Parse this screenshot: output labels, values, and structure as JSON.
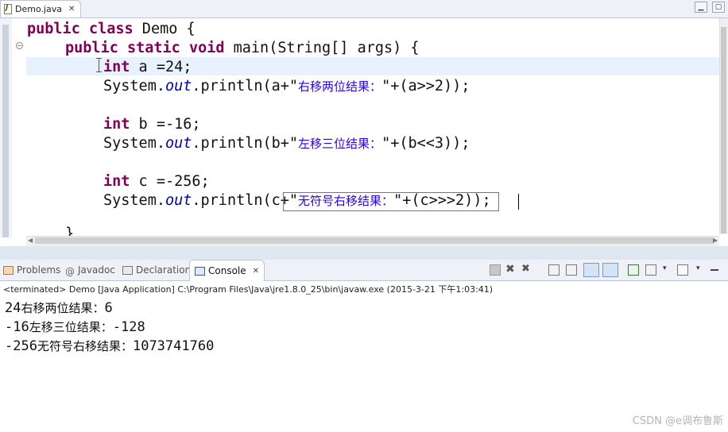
{
  "editor": {
    "tab_name": "Demo.java",
    "tab_close": "✕",
    "code": {
      "l1_kw1": "public",
      "l1_kw2": "class",
      "l1_rest": " Demo {",
      "l2_kw1": "public",
      "l2_kw2": "static",
      "l2_kw3": "void",
      "l2_rest": " main(String[] args) {",
      "l3_kw": "int",
      "l3_rest": " a =24;",
      "l4_a": "System.",
      "l4_out": "out",
      "l4_b": ".println(a+\"",
      "l4_str": "右移两位结果：",
      "l4_c": "\"+(a>>2));",
      "l6_kw": "int",
      "l6_rest": " b =-16;",
      "l7_a": "System.",
      "l7_out": "out",
      "l7_b": ".println(b+\"",
      "l7_str": "左移三位结果：",
      "l7_c": "\"+(b<<3));",
      "l9_kw": "int",
      "l9_rest": " c =-256;",
      "l10_a": "System.",
      "l10_out": "out",
      "l10_b": ".println(c+\"",
      "l10_str": "无符号右移结果：",
      "l10_c": "\"+(c>>>2));",
      "l11": "}"
    }
  },
  "views": {
    "tabs": [
      "Problems",
      "Javadoc",
      "Declaration",
      "Console"
    ],
    "console_close": "✕"
  },
  "console": {
    "header": "<terminated> Demo [Java Application] C:\\Program Files\\Java\\jre1.8.0_25\\bin\\javaw.exe (2015-3-21 下午1:03:41)",
    "lines": [
      {
        "num": "24",
        "text": "右移两位结果：",
        "val": "6"
      },
      {
        "num": "-16",
        "text": "左移三位结果：",
        "val": "-128"
      },
      {
        "num": "-256",
        "text": "无符号右移结果：",
        "val": "1073741760"
      }
    ]
  },
  "watermark": "CSDN @e调布鲁斯",
  "colors": {
    "keyword": "#7f0055",
    "string": "#2a00ff",
    "static_field": "#0000c0",
    "current_line": "#e8f2fe"
  }
}
